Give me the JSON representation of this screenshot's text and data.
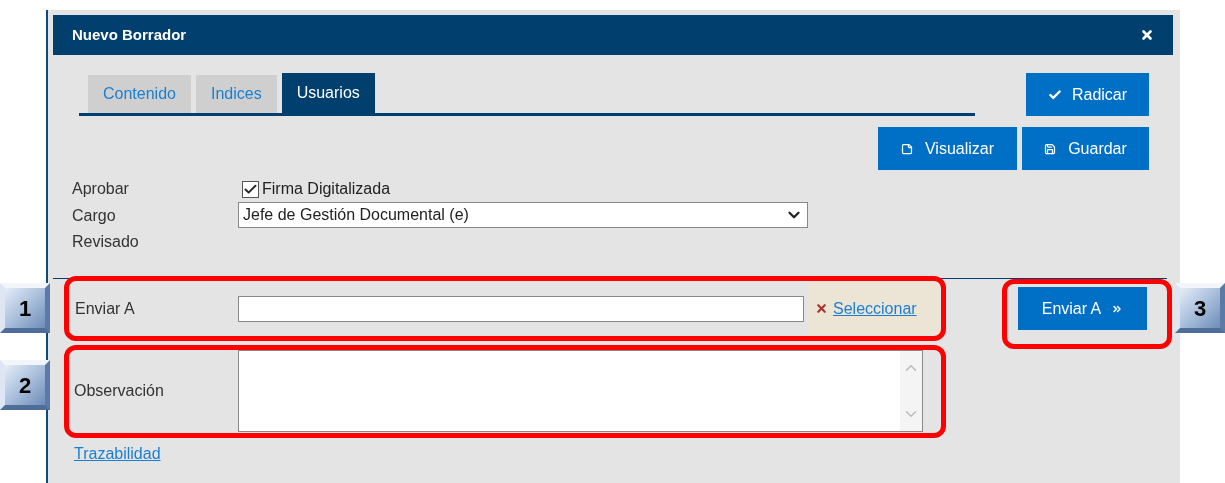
{
  "dialog": {
    "title": "Nuevo Borrador"
  },
  "tabs": [
    {
      "label": "Contenido",
      "selected": false
    },
    {
      "label": "Indices",
      "selected": false
    },
    {
      "label": "Usuarios",
      "selected": true
    }
  ],
  "primary_action": {
    "label": "Radicar"
  },
  "actions": [
    {
      "label": "Visualizar",
      "kind": "preview"
    },
    {
      "label": "Guardar",
      "kind": "save"
    }
  ],
  "form": {
    "aprobar_label": "Aprobar",
    "firma": {
      "label": "Firma Digitalizada",
      "checked": true
    },
    "cargo_label": "Cargo",
    "cargo_value": "Jefe de Gestión Documental (e)",
    "revisado_label": "Revisado"
  },
  "send": {
    "label": "Enviar A",
    "select_link": "Seleccionar",
    "button": "Enviar A",
    "observation_label": "Observación",
    "trace_link": "Trazabilidad"
  },
  "annotations": [
    {
      "label": "1"
    },
    {
      "label": "2"
    },
    {
      "label": "3"
    }
  ]
}
